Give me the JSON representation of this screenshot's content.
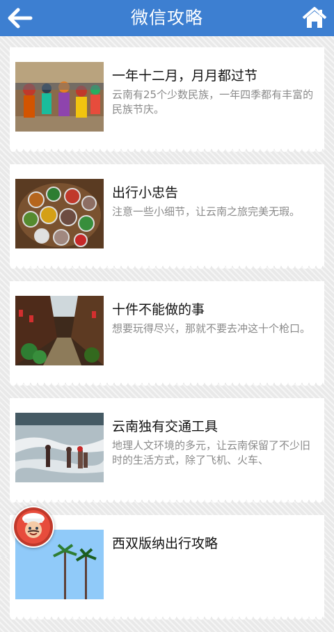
{
  "header": {
    "title": "微信攻略",
    "back_icon": "arrow-left-icon",
    "home_icon": "home-icon"
  },
  "items": [
    {
      "title": "一年十二月，月月都过节",
      "desc": "云南有25个少数民族，一年四季都有丰富的民族节庆。",
      "image": "festival-photo"
    },
    {
      "title": "出行小忠告",
      "desc": "注意一些小细节，让云南之旅完美无瑕。",
      "image": "food-table-photo"
    },
    {
      "title": "十件不能做的事",
      "desc": "想要玩得尽兴，那就不要去冲这十个枪口。",
      "image": "old-street-photo"
    },
    {
      "title": "云南独有交通工具",
      "desc": "地理人文环境的多元，让云南保留了不少旧时的生活方式，除了飞机、火车、",
      "image": "river-crossing-photo"
    },
    {
      "title": "西双版纳出行攻略",
      "desc": "",
      "image": "palm-trees-photo"
    }
  ],
  "floating_avatar": "chef-mascot-icon"
}
